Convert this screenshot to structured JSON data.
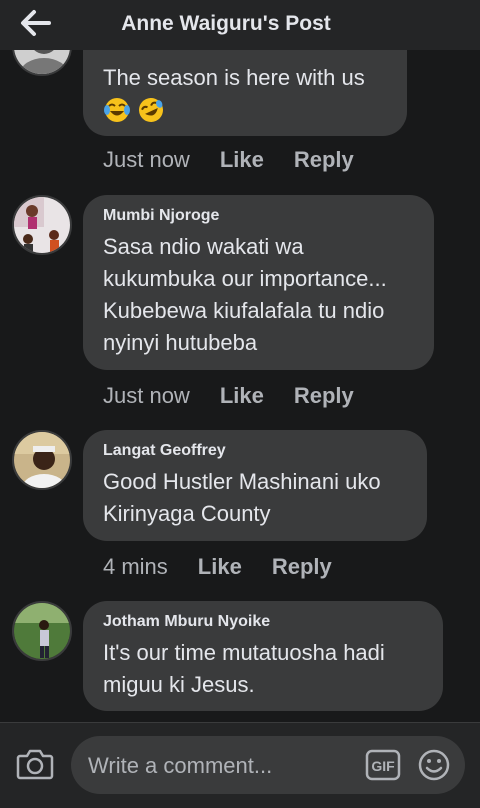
{
  "header": {
    "title": "Anne Waiguru's Post",
    "back_icon": "arrow-left-icon"
  },
  "comments": [
    {
      "author": "",
      "text": "The season is here with us",
      "emojis": [
        "face-with-tears-of-joy-icon",
        "rolling-on-floor-laughing-icon"
      ],
      "time": "Just now",
      "like": "Like",
      "reply": "Reply"
    },
    {
      "author": "Mumbi Njoroge",
      "text": "Sasa ndio wakati wa\nkukumbuka our importance...\nKubebewa kiufalafala tu ndio\nnyinyi hutubeba",
      "time": "Just now",
      "like": "Like",
      "reply": "Reply"
    },
    {
      "author": "Langat Geoffrey",
      "text": "Good Hustler Mashinani uko\nKirinyaga County",
      "time": "4 mins",
      "like": "Like",
      "reply": "Reply"
    },
    {
      "author": "Jotham Mburu Nyoike",
      "text": "It's  our time mutatuosha hadi\nmiguu ki Jesus.",
      "time": "",
      "like": "",
      "reply": ""
    }
  ],
  "composer": {
    "placeholder": "Write a comment...",
    "camera_icon": "camera-icon",
    "gif_icon": "gif-icon",
    "emoji_icon": "smiley-icon"
  },
  "colors": {
    "background": "#18191a",
    "bubble": "#3a3b3c",
    "text": "#e4e6eb",
    "muted": "#b0b3b8"
  }
}
